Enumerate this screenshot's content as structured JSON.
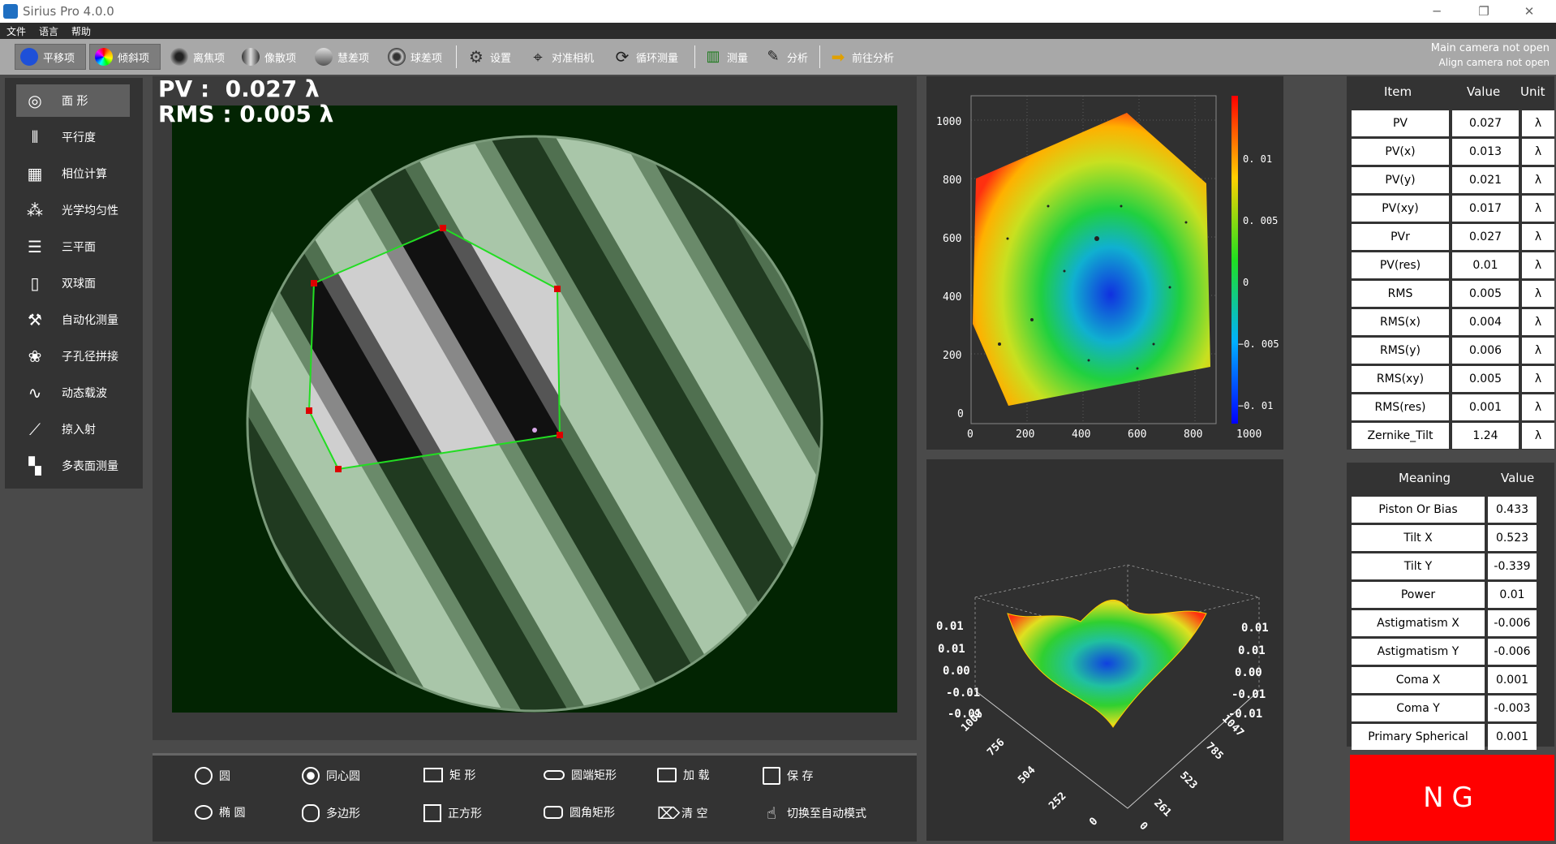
{
  "window": {
    "title": "Sirius Pro 4.0.0",
    "minimize": "─",
    "restore": "❐",
    "close": "✕"
  },
  "menu": [
    "文件",
    "语言",
    "帮助"
  ],
  "toolbar": {
    "items": [
      {
        "label": "平移项",
        "icon": "circle-blue-icon"
      },
      {
        "label": "倾斜项",
        "icon": "rainbow-circle-icon"
      },
      {
        "label": "离焦项",
        "icon": "defocus-icon"
      },
      {
        "label": "像散项",
        "icon": "astigmatism-icon"
      },
      {
        "label": "慧差项",
        "icon": "coma-icon"
      },
      {
        "label": "球差项",
        "icon": "spherical-icon"
      },
      {
        "label": "设置",
        "icon": "gear-icon"
      },
      {
        "label": "对准相机",
        "icon": "align-camera-icon"
      },
      {
        "label": "循环测量",
        "icon": "cycle-icon"
      },
      {
        "label": "测量",
        "icon": "measure-icon"
      },
      {
        "label": "分析",
        "icon": "edit-icon"
      },
      {
        "label": "前往分析",
        "icon": "arrow-right-icon"
      }
    ],
    "camera_status_main": "Main camera not open",
    "camera_status_align": "Align camera not open"
  },
  "sidebar": {
    "items": [
      {
        "label": "面 形",
        "icon": "aperture-icon"
      },
      {
        "label": "平行度",
        "icon": "parallel-icon"
      },
      {
        "label": "相位计算",
        "icon": "calculator-icon"
      },
      {
        "label": "光学均匀性",
        "icon": "uniformity-icon"
      },
      {
        "label": "三平面",
        "icon": "three-plane-icon"
      },
      {
        "label": "双球面",
        "icon": "double-sphere-icon"
      },
      {
        "label": "自动化测量",
        "icon": "robot-arm-icon"
      },
      {
        "label": "子孔径拼接",
        "icon": "stitch-icon"
      },
      {
        "label": "动态载波",
        "icon": "wave-icon"
      },
      {
        "label": "掠入射",
        "icon": "grazing-icon"
      },
      {
        "label": "多表面测量",
        "icon": "multi-surface-icon"
      }
    ]
  },
  "measurement": {
    "pv_label": "PV :",
    "pv_value": "0.027 λ",
    "rms_label": "RMS :",
    "rms_value": "0.005 λ"
  },
  "shapes": {
    "col1": [
      "圆",
      "椭 圆"
    ],
    "col2": [
      "同心圆",
      "多边形"
    ],
    "col3": [
      "矩 形",
      "正方形"
    ],
    "col4": [
      "圆端矩形",
      "圆角矩形"
    ],
    "col5": [
      "加 载",
      "清 空"
    ],
    "col6": [
      "保 存",
      "切换至自动模式"
    ]
  },
  "plot2d": {
    "y_ticks": [
      "1000",
      "800",
      "600",
      "400",
      "200",
      "0"
    ],
    "x_ticks": [
      "0",
      "200",
      "400",
      "600",
      "800",
      "1000"
    ],
    "colorbar_ticks": [
      "0. 01",
      "0. 005",
      "0",
      "−0. 005",
      "−0. 01"
    ]
  },
  "plot3d": {
    "z_left": [
      "0.01",
      "0.01",
      "0.00",
      "-0.01",
      "-0.01"
    ],
    "z_right": [
      "0.01",
      "0.01",
      "0.00",
      "-0.01",
      "-0.01"
    ],
    "x_ticks": [
      "1009",
      "756",
      "504",
      "252",
      "0"
    ],
    "y_ticks": [
      "1047",
      "785",
      "523",
      "261",
      "0"
    ]
  },
  "table1": {
    "headers": [
      "Item",
      "Value",
      "Unit"
    ],
    "rows": [
      [
        "PV",
        "0.027",
        "λ"
      ],
      [
        "PV(x)",
        "0.013",
        "λ"
      ],
      [
        "PV(y)",
        "0.021",
        "λ"
      ],
      [
        "PV(xy)",
        "0.017",
        "λ"
      ],
      [
        "PVr",
        "0.027",
        "λ"
      ],
      [
        "PV(res)",
        "0.01",
        "λ"
      ],
      [
        "RMS",
        "0.005",
        "λ"
      ],
      [
        "RMS(x)",
        "0.004",
        "λ"
      ],
      [
        "RMS(y)",
        "0.006",
        "λ"
      ],
      [
        "RMS(xy)",
        "0.005",
        "λ"
      ],
      [
        "RMS(res)",
        "0.001",
        "λ"
      ],
      [
        "Zernike_Tilt",
        "1.24",
        "λ"
      ]
    ]
  },
  "table2": {
    "headers": [
      "Meaning",
      "Value"
    ],
    "rows": [
      [
        "Piston Or Bias",
        "0.433"
      ],
      [
        "Tilt X",
        "0.523"
      ],
      [
        "Tilt Y",
        "-0.339"
      ],
      [
        "Power",
        "0.01"
      ],
      [
        "Astigmatism X",
        "-0.006"
      ],
      [
        "Astigmatism Y",
        "-0.006"
      ],
      [
        "Coma X",
        "0.001"
      ],
      [
        "Coma Y",
        "-0.003"
      ],
      [
        "Primary Spherical",
        "0.001"
      ]
    ]
  },
  "result": "NG"
}
